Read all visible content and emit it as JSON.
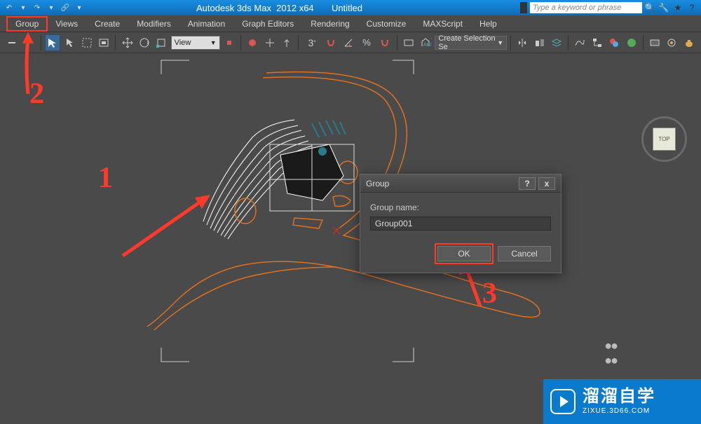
{
  "title": "Autodesk 3ds Max  2012 x64       Untitled",
  "search_placeholder": "Type a keyword or phrase",
  "menu": {
    "group": "Group",
    "views": "Views",
    "create": "Create",
    "modifiers": "Modifiers",
    "animation": "Animation",
    "graph_editors": "Graph Editors",
    "rendering": "Rendering",
    "customize": "Customize",
    "maxscript": "MAXScript",
    "help": "Help"
  },
  "toolbar": {
    "view_dropdown": "View",
    "selection_set": "Create Selection Se",
    "angle_label": "3"
  },
  "viewcube": {
    "face": "TOP"
  },
  "dialog": {
    "title": "Group",
    "label": "Group name:",
    "value": "Group001",
    "ok": "OK",
    "cancel": "Cancel",
    "help": "?",
    "close": "x"
  },
  "annotations": {
    "a1": "1",
    "a2": "2",
    "a3": "3"
  },
  "watermark": {
    "cn": "溜溜自学",
    "en": "ZIXUE.3D66.COM"
  }
}
